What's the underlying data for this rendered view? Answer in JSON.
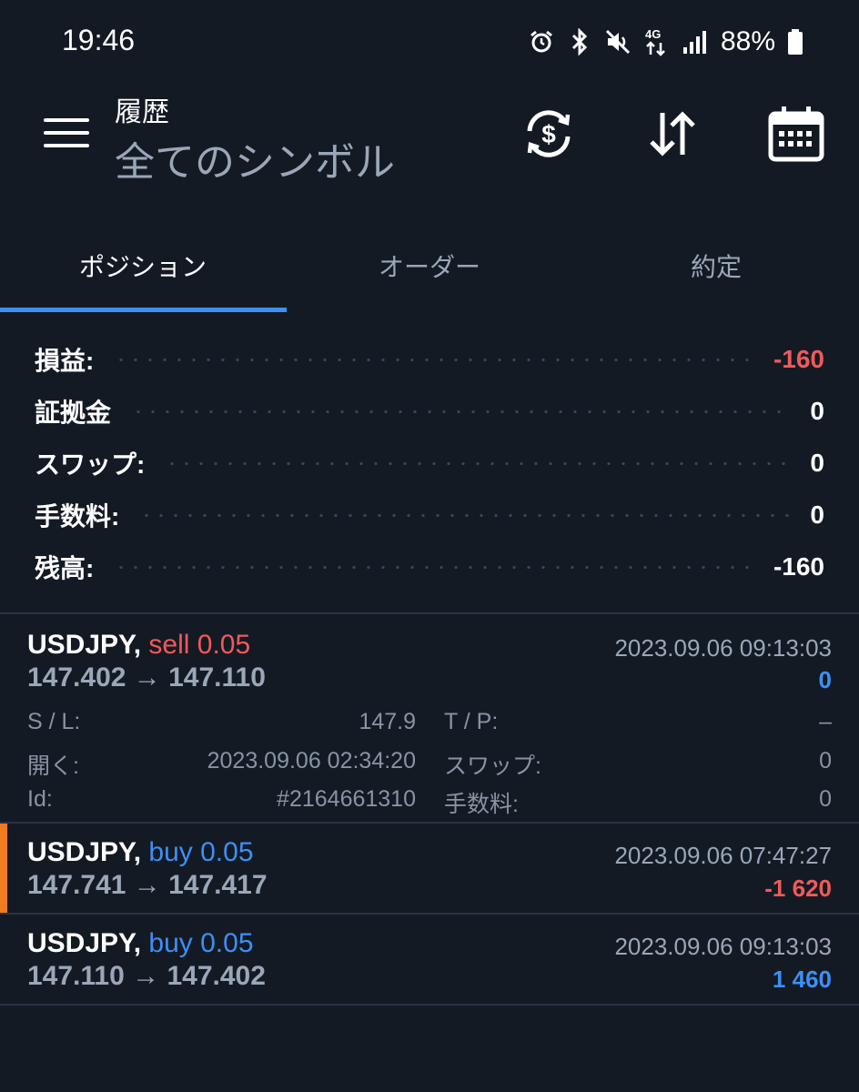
{
  "status": {
    "time": "19:46",
    "battery": "88%",
    "network": "4G",
    "icons": [
      "alarm-icon",
      "bluetooth-icon",
      "mute-icon",
      "network-4g-icon",
      "signal-icon",
      "battery-icon"
    ]
  },
  "header": {
    "title": "履歴",
    "subtitle": "全てのシンボル",
    "icons": [
      "currency-refresh-icon",
      "sort-icon",
      "calendar-icon"
    ]
  },
  "tabs": [
    {
      "label": "ポジション",
      "active": true
    },
    {
      "label": "オーダー",
      "active": false
    },
    {
      "label": "約定",
      "active": false
    }
  ],
  "summary": {
    "profit_label": "損益:",
    "profit_value": "-160",
    "margin_label": "証拠金",
    "margin_value": "0",
    "swap_label": "スワップ:",
    "swap_value": "0",
    "commission_label": "手数料:",
    "commission_value": "0",
    "balance_label": "残高:",
    "balance_value": "-160"
  },
  "deals": [
    {
      "symbol": "USDJPY,",
      "side": "sell 0.05",
      "time": "2023.09.06 09:13:03",
      "prices": "147.402 → 147.110",
      "profit": "0",
      "expanded": true,
      "details": {
        "sl_label": "S / L:",
        "sl_value": "147.9",
        "tp_label": "T / P:",
        "tp_value": "–",
        "open_label": "開く:",
        "open_value": "2023.09.06 02:34:20",
        "swap_label": "スワップ:",
        "swap_value": "0",
        "id_label": "Id:",
        "id_value": "#2164661310",
        "commission_label": "手数料:",
        "commission_value": "0"
      }
    },
    {
      "symbol": "USDJPY,",
      "side": "buy 0.05",
      "time": "2023.09.06 07:47:27",
      "prices": "147.741 → 147.417",
      "profit": "-1 620",
      "highlighted": true
    },
    {
      "symbol": "USDJPY,",
      "side": "buy 0.05",
      "time": "2023.09.06 09:13:03",
      "prices": "147.110 → 147.402",
      "profit": "1 460"
    }
  ],
  "colors": {
    "background": "#141a24",
    "accent_blue": "#3d8ff5",
    "negative_red": "#f05a5a",
    "muted_text": "#9aa7b8",
    "highlight_orange": "#f07a1e"
  }
}
